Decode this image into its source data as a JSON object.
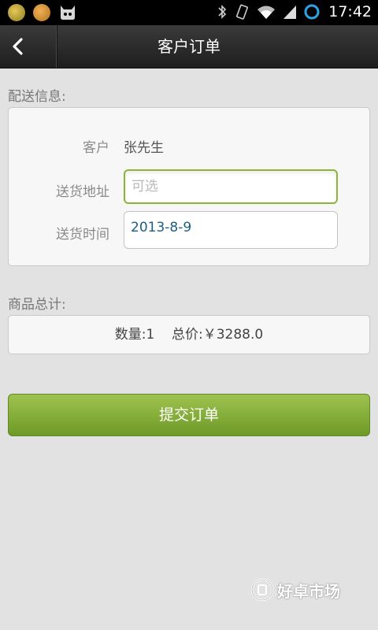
{
  "status_bar": {
    "time": "17:42",
    "icons": [
      "notification-green-icon",
      "notification-orange-icon",
      "cyanogen-cat-icon",
      "bluetooth-icon",
      "vibrate-icon",
      "wifi-icon",
      "signal-icon",
      "battery-ring-icon"
    ]
  },
  "header": {
    "back_icon": "chevron-left-icon",
    "title": "客户订单"
  },
  "delivery": {
    "section_label": "配送信息:",
    "customer_label": "客户",
    "customer_value": "张先生",
    "address_label": "送货地址",
    "address_placeholder": "可选",
    "address_value": "",
    "time_label": "送货时间",
    "time_value": "2013-8-9"
  },
  "summary": {
    "section_label": "商品总计:",
    "quantity_label": "数量:",
    "quantity_value": "1",
    "total_label": "总价:",
    "total_value": "￥3288.0"
  },
  "actions": {
    "submit_label": "提交订单"
  },
  "watermark": {
    "text": "好卓市场"
  },
  "colors": {
    "accent_green": "#8cb43a",
    "button_green_top": "#9fc24f",
    "button_green_bottom": "#6d9a27",
    "date_text": "#1e5d82",
    "header_bg": "#2b2b2b"
  }
}
